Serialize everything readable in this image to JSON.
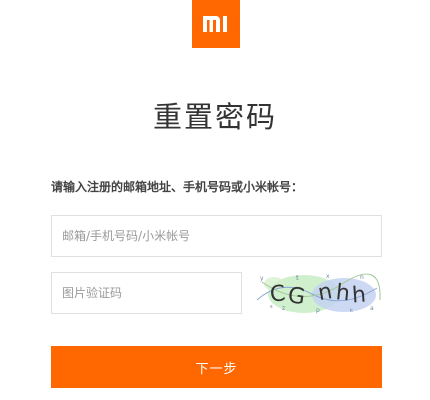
{
  "brand": {
    "logo_text": "mi",
    "logo_color": "#ff6700"
  },
  "page": {
    "title": "重置密码",
    "instruction": "请输入注册的邮箱地址、手机号码或小米帐号："
  },
  "form": {
    "account_placeholder": "邮箱/手机号码/小米帐号",
    "captcha_placeholder": "图片验证码",
    "captcha_text": "CG nhh",
    "next_label": "下一步",
    "button_color": "#ff6700"
  }
}
